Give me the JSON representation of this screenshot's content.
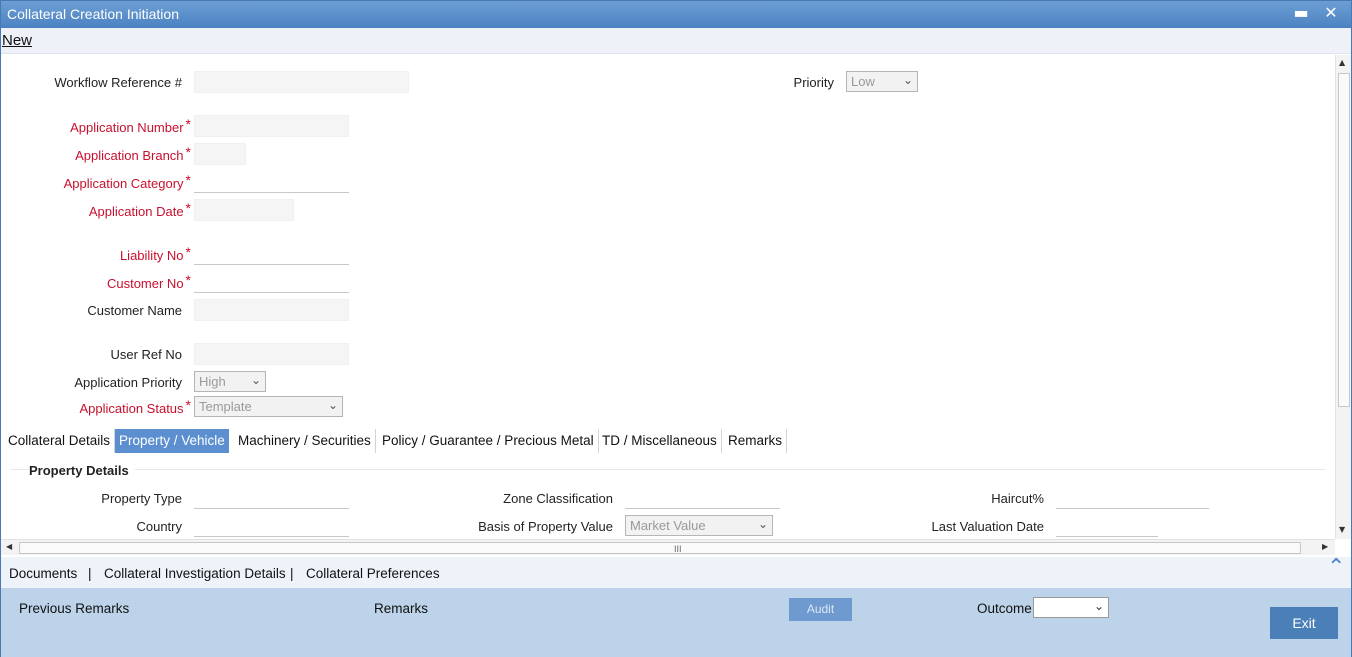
{
  "window": {
    "title": "Collateral Creation Initiation",
    "minimize_icon": "minimize-icon",
    "close_icon": "close-icon"
  },
  "menu": {
    "new_label": "New"
  },
  "form": {
    "workflow_ref_label": "Workflow Reference #",
    "priority_label": "Priority",
    "priority_value": "Low",
    "application_number_label": "Application Number",
    "application_branch_label": "Application Branch",
    "application_category_label": "Application Category",
    "application_date_label": "Application Date",
    "liability_no_label": "Liability No",
    "customer_no_label": "Customer No",
    "customer_name_label": "Customer Name",
    "user_ref_label": "User Ref No",
    "application_priority_label": "Application Priority",
    "application_priority_value": "High",
    "application_status_label": "Application Status",
    "application_status_value": "Template",
    "required_mark": "*"
  },
  "tabs": [
    {
      "label": "Collateral Details"
    },
    {
      "label": "Property / Vehicle"
    },
    {
      "label": "Machinery / Securities"
    },
    {
      "label": "Policy / Guarantee / Precious Metal"
    },
    {
      "label": "TD / Miscellaneous"
    },
    {
      "label": "Remarks"
    }
  ],
  "active_tab": "Property / Vehicle",
  "property": {
    "section_title": "Property Details",
    "property_type_label": "Property Type",
    "country_label": "Country",
    "zone_label": "Zone Classification",
    "basis_label": "Basis of Property Value",
    "basis_value": "Market Value",
    "haircut_label": "Haircut%",
    "last_valuation_label": "Last Valuation Date"
  },
  "scroll": {
    "grip": "III"
  },
  "links": {
    "documents": "Documents",
    "investigation": "Collateral Investigation Details",
    "preferences": "Collateral Preferences",
    "separator": "|"
  },
  "footer": {
    "previous_remarks": "Previous Remarks",
    "remarks": "Remarks",
    "audit": "Audit",
    "outcome": "Outcome",
    "exit": "Exit"
  },
  "colors": {
    "title_bar": "#4b82c2",
    "required": "#c8102e",
    "active_tab": "#5b8fd0",
    "footer": "#bcd3ea"
  }
}
